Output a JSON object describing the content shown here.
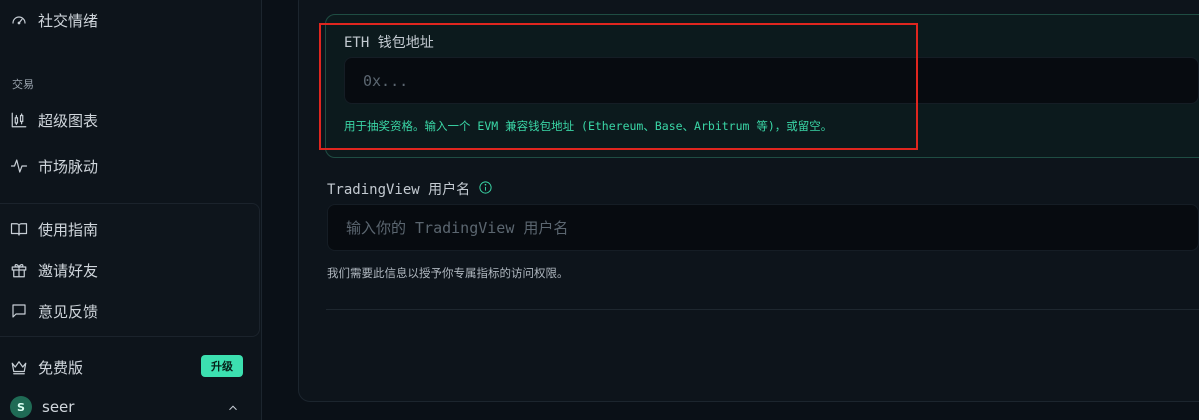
{
  "sidebar": {
    "top_item": {
      "label": "社交情绪",
      "icon": "gauge-icon"
    },
    "section_trade": "交易",
    "trade_items": [
      {
        "label": "超级图表",
        "icon": "candlestick-chart-icon"
      },
      {
        "label": "市场脉动",
        "icon": "pulse-icon"
      }
    ],
    "help_items": [
      {
        "label": "使用指南",
        "icon": "book-icon"
      },
      {
        "label": "邀请好友",
        "icon": "gift-icon"
      },
      {
        "label": "意见反馈",
        "icon": "message-icon"
      }
    ],
    "plan": {
      "label": "免费版",
      "icon": "crown-icon",
      "upgrade_label": "升级"
    },
    "user": {
      "initial": "S",
      "name": "seer",
      "avatar_color": "#1f6b55"
    }
  },
  "form": {
    "eth": {
      "label": "ETH 钱包地址",
      "placeholder": "0x...",
      "hint": "用于抽奖资格。输入一个 EVM 兼容钱包地址 (Ethereum、Base、Arbitrum 等)，或留空。"
    },
    "tradingview": {
      "label": "TradingView 用户名",
      "placeholder": "输入你的 TradingView 用户名",
      "hint": "我们需要此信息以授予你专属指标的访问权限。"
    }
  },
  "colors": {
    "accent": "#3ce0b0",
    "highlight_box": "#e0261f",
    "background": "#0a1017"
  }
}
